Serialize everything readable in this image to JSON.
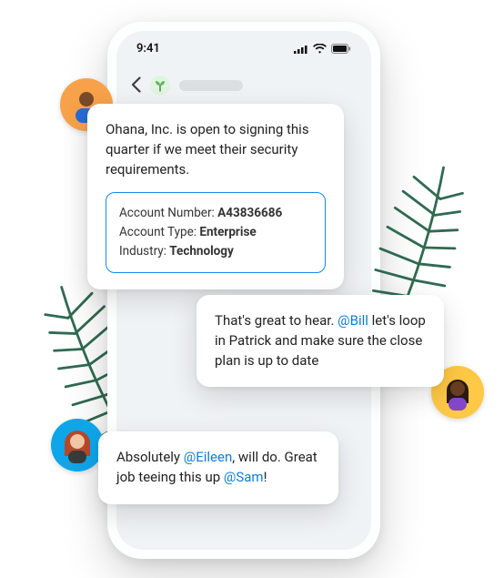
{
  "status": {
    "time": "9:41"
  },
  "thread": {
    "avatar_emoji": "🌴"
  },
  "messages": {
    "m1": {
      "text": "Ohana, Inc. is open to signing this quarter if we meet their security requirements.",
      "account": {
        "number_label": "Account Number:",
        "number_value": "A43836686",
        "type_label": "Account Type:",
        "type_value": "Enterprise",
        "industry_label": "Industry:",
        "industry_value": "Technology"
      }
    },
    "m2": {
      "before": "That's great to hear. ",
      "mention1": "@Bill",
      "after": " let's loop in Patrick and make sure the close plan is up to date"
    },
    "m3": {
      "a": "Absolutely ",
      "mention1": "@Eileen",
      "b": ", will do. Great job teeing this up ",
      "mention2": "@Sam",
      "c": "!"
    }
  },
  "colors": {
    "accent": "#1589ee",
    "mention": "#0d7dd8"
  }
}
